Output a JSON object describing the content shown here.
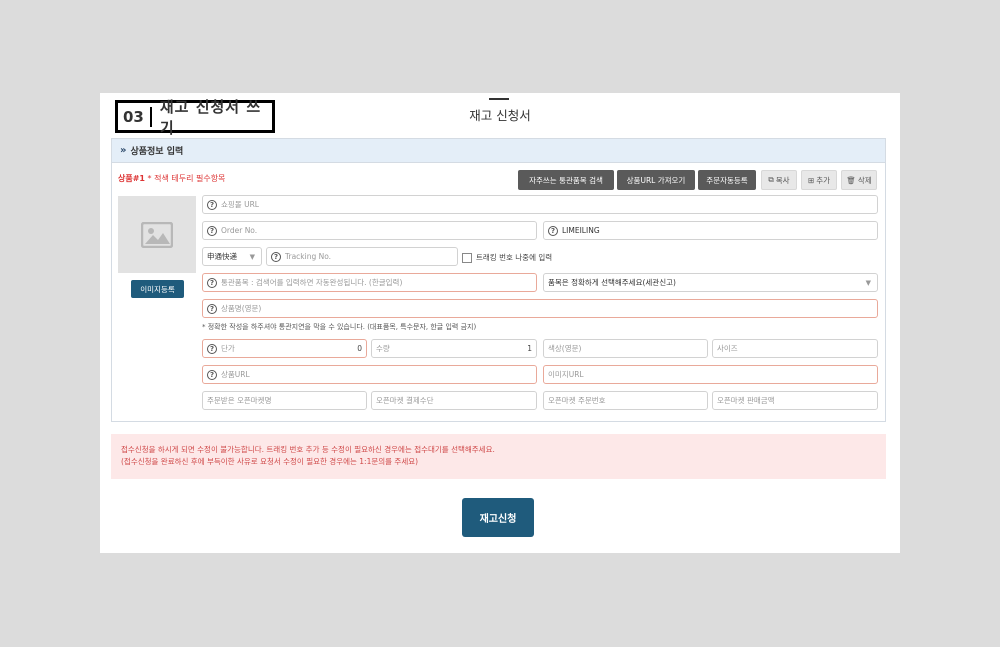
{
  "step": {
    "number": "03",
    "title": "재고 신청서 쓰기"
  },
  "page_title": "재고 신청서",
  "panel": {
    "header": "상품정보 입력",
    "product_label": "상품#1",
    "required_note": "* 적색 테두리 필수항목"
  },
  "toolbar": {
    "customs_search": "자주쓰는 통관품목 검색",
    "fetch_url": "상품URL 가져오기",
    "auto_order": "주문자동등록",
    "copy": "복사",
    "add": "추가",
    "delete": "삭제"
  },
  "image": {
    "register_button": "이미지등록"
  },
  "form": {
    "mall_url": {
      "placeholder": "쇼핑몰 URL"
    },
    "order_no": {
      "placeholder": "Order No."
    },
    "seller": {
      "value": "LIMEILING"
    },
    "courier": {
      "value": "申通快递"
    },
    "tracking_no": {
      "placeholder": "Tracking No."
    },
    "tracking_later": "트래킹 번호 나중에 입력",
    "customs_item": {
      "placeholder": "통관품목 : 검색어를 입력하면 자동완성됩니다. (한글입력)"
    },
    "category": {
      "value": "품목은 정확하게 선택해주세요(세관신고)"
    },
    "product_name_en": {
      "placeholder": "상품명(영문)"
    },
    "note": "* 정확한 작성을 하주셔야 통관지연을 막을 수 있습니다. (대표품목, 특수문자, 한글 입력 금지)",
    "unit_price": {
      "placeholder": "단가",
      "value": "0"
    },
    "quantity": {
      "placeholder": "수량",
      "value": "1"
    },
    "color": {
      "placeholder": "색상(영문)"
    },
    "size": {
      "placeholder": "사이즈"
    },
    "product_url": {
      "placeholder": "상품URL"
    },
    "image_url": {
      "placeholder": "이미지URL"
    },
    "market_name": {
      "placeholder": "주문받은 오픈마켓명"
    },
    "market_payment": {
      "placeholder": "오픈마켓 결제수단"
    },
    "market_order_no": {
      "placeholder": "오픈마켓 주문번호"
    },
    "market_sale_price": {
      "placeholder": "오픈마켓 판매금액"
    }
  },
  "warning": {
    "line1": "접수신청을 하시게 되면 수정이 불가능합니다. 트래킹 번호 추가 등 수정이 필요하신 경우에는 접수대기를 선택해주세요.",
    "line2": "(접수신청을 완료하신 후에 부득이한 사유로 요청서 수정이 필요한 경우에는 1:1문의를 주세요)"
  },
  "submit": "재고신청",
  "colors": {
    "primary": "#1f5b7c",
    "required_border": "#e9a99a",
    "warning_bg": "#fde8e8",
    "warning_text": "#d04a4a"
  }
}
